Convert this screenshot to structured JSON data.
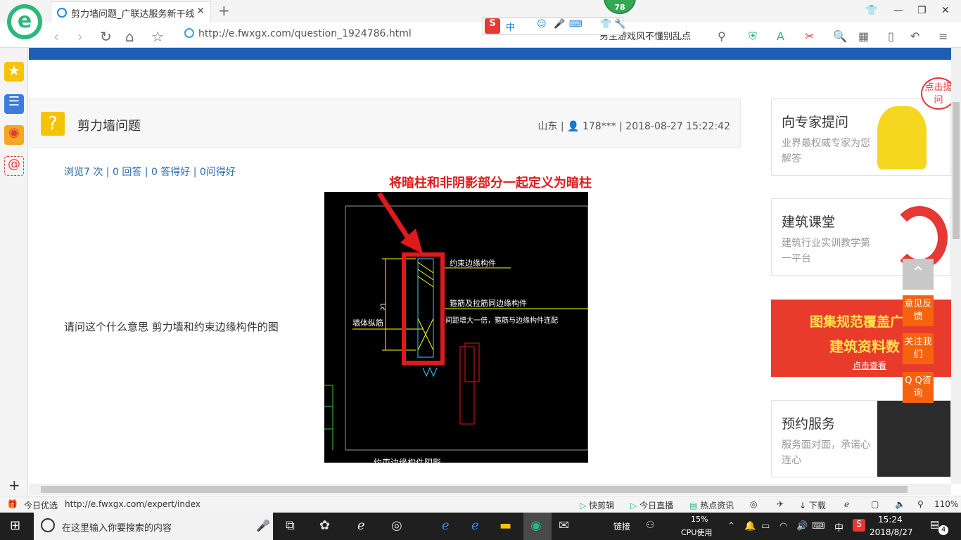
{
  "browser": {
    "tab_title": "剪力墙问题_广联达服务新干线",
    "address": "http://e.fwxgx.com/question_1924786.html",
    "search_text": "男主游戏风不懂别乱点",
    "badge": "78",
    "ime_label": "中"
  },
  "question": {
    "title": "剪力墙问题",
    "region": "山东",
    "user": "178***",
    "datetime": "2018-08-27 15:22:42",
    "stats": "浏览7 次 | 0 回答 | 0 答得好 | 0问得好",
    "body": "请问这个什么意思  剪力墙和约束边缘构件的图",
    "annotation": "将暗柱和非阴影部分一起定义为暗柱",
    "cad_labels": {
      "constraint": "约束边缘构件",
      "stirrup": "箍筋及拉筋同边缘构件",
      "spacing": "间距增大一倍，箍筋与边缘构件连配",
      "wall_bar": "墙体纵筋",
      "lc": "Lc",
      "bottom": "约束边缘构件阴影"
    }
  },
  "sidebar_cards": [
    {
      "title": "向专家提问",
      "desc": "业界最权威专家为您解答"
    },
    {
      "title": "建筑课堂",
      "desc": "建筑行业实训教学第一平台"
    },
    {
      "title": "",
      "banner1": "图集规范覆盖广",
      "banner2": "建筑资料数",
      "banner3": "点击查看"
    },
    {
      "title": "预约服务",
      "desc": "服务面对面，承诺心连心"
    }
  ],
  "float_buttons": [
    "意见反馈",
    "关注我们",
    "Q Q咨询"
  ],
  "bubble": "点击提问",
  "status": {
    "left": "今日优选",
    "url": "http://e.fwxgx.com/expert/index",
    "items": [
      "快剪辑",
      "今日直播",
      "热点资讯",
      "下载"
    ],
    "zoom": "110%"
  },
  "taskbar": {
    "search_placeholder": "在这里输入你要搜索的内容",
    "links": "链接",
    "cpu_percent": "15%",
    "cpu_label": "CPU使用",
    "lang": "中",
    "time": "15:24",
    "date": "2018/8/27",
    "notif_count": "4"
  },
  "colors": {
    "accent": "#2db77b",
    "blue": "#1d5fb6",
    "orange": "#f5630f",
    "red": "#e0191b"
  }
}
